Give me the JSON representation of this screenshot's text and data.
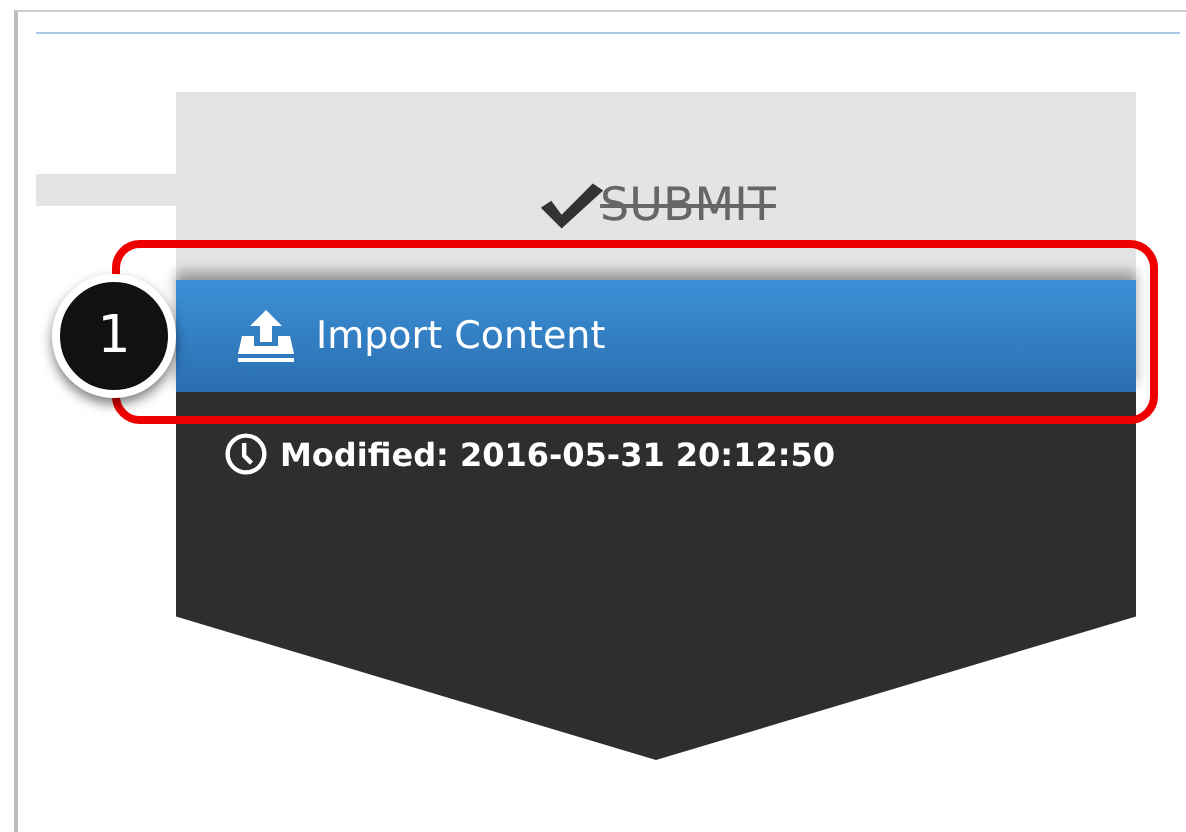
{
  "submit": {
    "label": "SUBMIT",
    "disabled": true
  },
  "import_button": {
    "label": "Import Content"
  },
  "modified": {
    "text": "Modified: 2016-05-31 20:12:50"
  },
  "callout": {
    "number": "1"
  }
}
